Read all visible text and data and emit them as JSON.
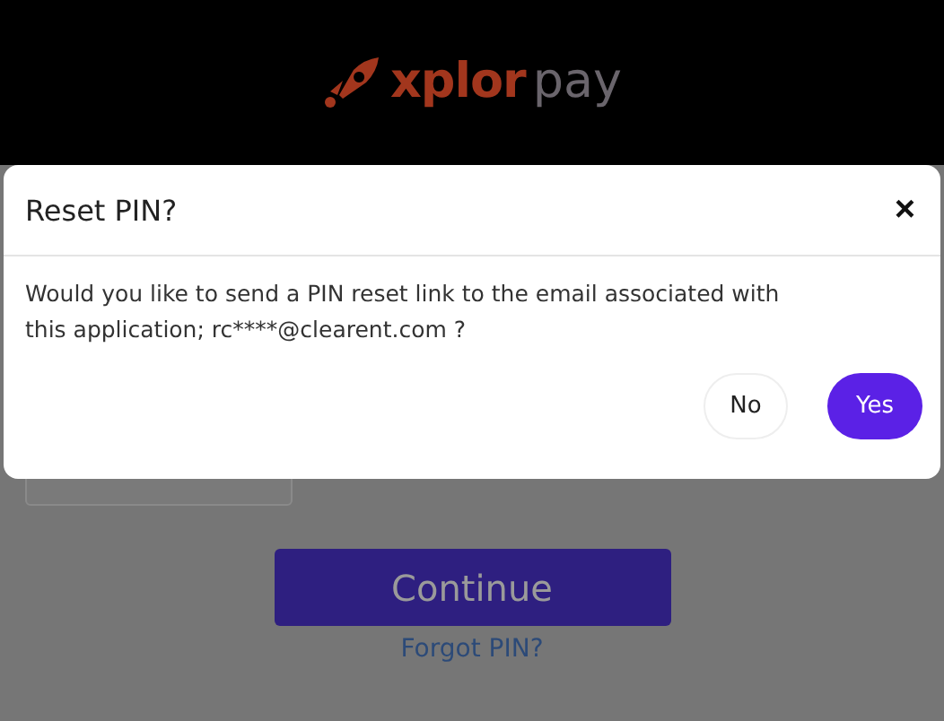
{
  "logo": {
    "brand": "xplor",
    "product": "pay"
  },
  "page": {
    "continue_button": "Continue",
    "forgot_link": "Forgot PIN?"
  },
  "dialog": {
    "title": "Reset PIN?",
    "close": "×",
    "message": "Would you like to send a PIN reset link to the email associated with this application; rc****@clearent.com ?",
    "buttons": [
      {
        "label": "No",
        "kind": "secondary"
      },
      {
        "label": "Yes",
        "kind": "primary"
      }
    ]
  }
}
